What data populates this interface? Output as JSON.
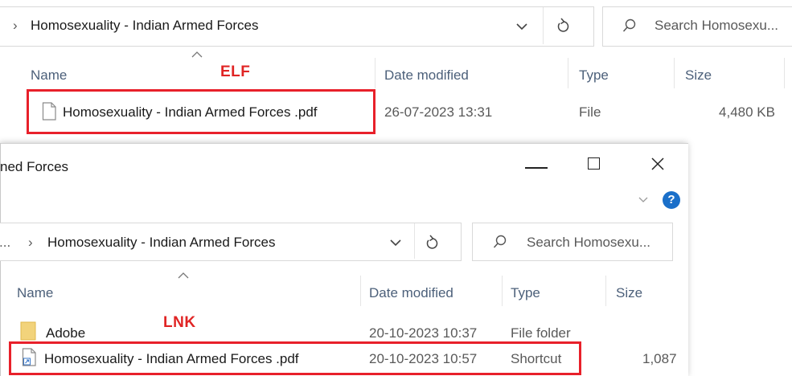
{
  "back_window": {
    "address_chevron": "›",
    "address_path": "Homosexuality - Indian Armed Forces",
    "search_placeholder": "Search Homosexu...",
    "columns": {
      "name": "Name",
      "date": "Date modified",
      "type": "Type",
      "size": "Size"
    },
    "file": {
      "name": "Homosexuality - Indian Armed Forces .pdf",
      "date": "26-07-2023 13:31",
      "type": "File",
      "size": "4,480 KB"
    },
    "annotation": "ELF"
  },
  "front_window": {
    "title": "ned Forces",
    "minimize_glyph": "—",
    "maximize_glyph": "☐",
    "close_glyph": "✕",
    "help_glyph": "?",
    "address_prefix": "...",
    "address_chevron": "›",
    "address_path": "Homosexuality - Indian Armed Forces",
    "search_placeholder": "Search Homosexu...",
    "columns": {
      "name": "Name",
      "date": "Date modified",
      "type": "Type",
      "size": "Size"
    },
    "rows": [
      {
        "name": "Adobe",
        "date": "20-10-2023 10:37",
        "type": "File folder",
        "size": "",
        "icon": "folder-icon"
      },
      {
        "name": "Homosexuality - Indian Armed Forces .pdf",
        "date": "20-10-2023 10:57",
        "type": "Shortcut",
        "size": "1,087",
        "icon": "shortcut-file-icon"
      }
    ],
    "annotation": "LNK"
  },
  "colors": {
    "highlight": "#e8202a",
    "help_icon": "#1a6fc9",
    "folder": "#f2d37b"
  }
}
